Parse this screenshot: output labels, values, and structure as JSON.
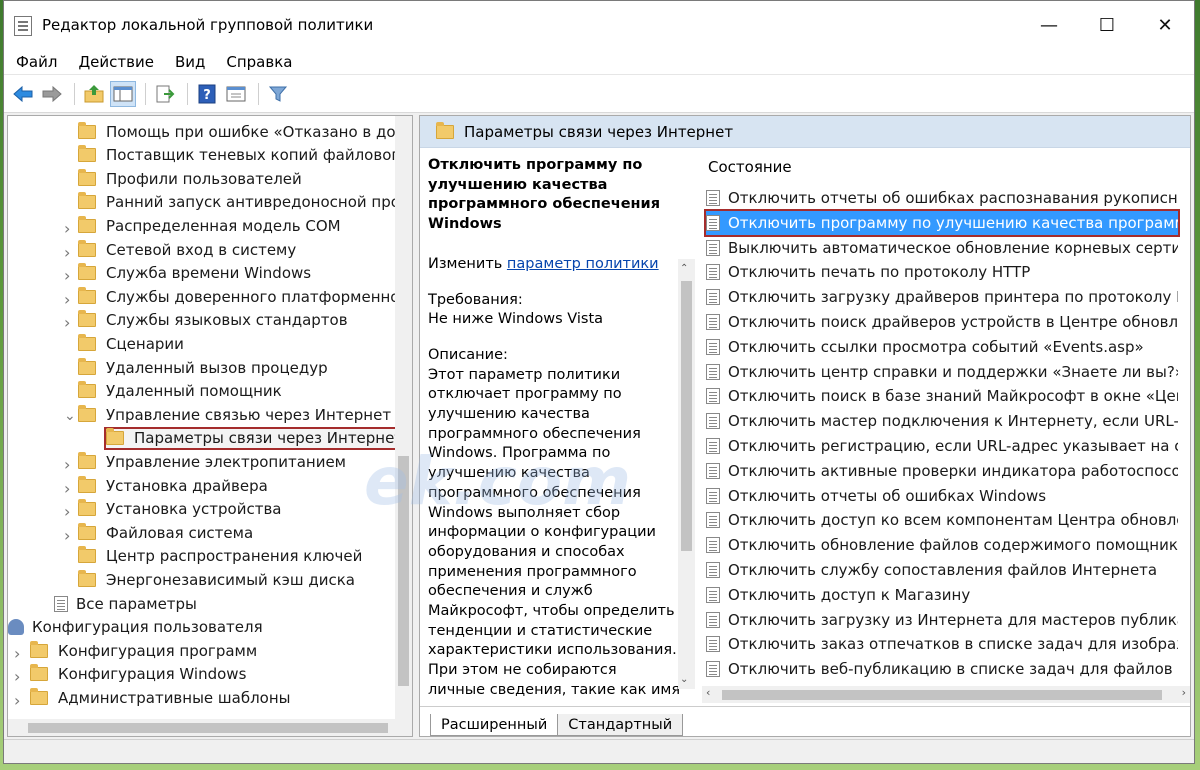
{
  "window": {
    "title": "Редактор локальной групповой политики"
  },
  "controls": {
    "minimize": "—",
    "maximize": "☐",
    "close": "✕"
  },
  "menu": [
    "Файл",
    "Действие",
    "Вид",
    "Справка"
  ],
  "toolbar_icons": [
    "back-arrow-icon",
    "forward-arrow-icon",
    "up-folder-icon",
    "show-hide-tree-icon",
    "export-list-icon",
    "help-icon",
    "properties-icon",
    "filter-icon"
  ],
  "tree": {
    "items": [
      {
        "label": "Помощь при ошибке «Отказано в дост",
        "expandable": false
      },
      {
        "label": "Поставщик теневых копий файлового",
        "expandable": false
      },
      {
        "label": "Профили пользователей",
        "expandable": false
      },
      {
        "label": "Ранний запуск антивредоносной прогр",
        "expandable": false
      },
      {
        "label": "Распределенная модель COM",
        "expandable": true
      },
      {
        "label": "Сетевой вход в систему",
        "expandable": true
      },
      {
        "label": "Служба времени Windows",
        "expandable": true
      },
      {
        "label": "Службы доверенного платформенного",
        "expandable": true
      },
      {
        "label": "Службы языковых стандартов",
        "expandable": true
      },
      {
        "label": "Сценарии",
        "expandable": false
      },
      {
        "label": "Удаленный вызов процедур",
        "expandable": false
      },
      {
        "label": "Удаленный помощник",
        "expandable": false
      },
      {
        "label": "Управление связью через Интернет",
        "expandable": true,
        "expanded": true
      },
      {
        "label": "Параметры связи через Интернет",
        "expandable": false,
        "selected": true
      },
      {
        "label": "Управление электропитанием",
        "expandable": true
      },
      {
        "label": "Установка драйвера",
        "expandable": true
      },
      {
        "label": "Установка устройства",
        "expandable": true
      },
      {
        "label": "Файловая система",
        "expandable": true
      },
      {
        "label": "Центр распространения ключей",
        "expandable": false
      },
      {
        "label": "Энергонезависимый кэш диска",
        "expandable": false
      },
      {
        "label": "Все параметры",
        "expandable": false
      },
      {
        "label": "Конфигурация пользователя",
        "expandable": false
      },
      {
        "label": "Конфигурация программ",
        "expandable": true
      },
      {
        "label": "Конфигурация Windows",
        "expandable": true
      },
      {
        "label": "Административные шаблоны",
        "expandable": true
      }
    ]
  },
  "right": {
    "header": "Параметры связи через Интернет",
    "policy_title": "Отключить программу по улучшению качества программного обеспечения Windows",
    "edit_prefix": "Изменить",
    "edit_link": "параметр политики",
    "requirements_label": "Требования:",
    "requirements_value": "Не ниже Windows Vista",
    "description_label": "Описание:",
    "description_lines": [
      "Этот параметр политики",
      "отключает программу по",
      "улучшению качества",
      "программного обеспечения",
      "Windows. Программа по",
      "улучшению качества",
      "программного обеспечения",
      "Windows выполняет сбор",
      "информации о конфигурации",
      "оборудования и способах",
      "применения программного",
      "обеспечения и служб",
      "Майкрософт, чтобы определить",
      "тенденции и статистические",
      "характеристики использования.",
      "При этом не собираются",
      "личные сведения, такие как имя"
    ],
    "column_header": "Состояние",
    "policies": [
      "Отключить отчеты об ошибках распознавания рукописного т",
      "Отключить программу по улучшению качества программно",
      "Выключить автоматическое обновление корневых сертифика",
      "Отключить печать по протоколу HTTP",
      "Отключить загрузку драйверов принтера по протоколу HTTP",
      "Отключить поиск драйверов устройств в Центре обновления",
      "Отключить ссылки просмотра событий «Events.asp»",
      "Отключить центр справки и поддержки «Знаете ли вы?»",
      "Отключить поиск в базе знаний Майкрософт в окне «Центр с",
      "Отключить мастер подключения к Интернету, если URL-адре",
      "Отключить регистрацию, если URL-адрес указывает на сайт М",
      "Отключить активные проверки индикатора работоспособнос",
      "Отключить отчеты об ошибках Windows",
      "Отключить доступ ко всем компонентам Центра обновления",
      "Отключить обновление файлов содержимого помощника по",
      "Отключить службу сопоставления файлов Интернета",
      "Отключить доступ к Магазину",
      "Отключить загрузку из Интернета для мастеров публикаций и",
      "Отключить заказ отпечатков в списке задач для изображени",
      "Отключить веб-публикацию в списке задач для файлов и па"
    ],
    "selected_policy_index": 1,
    "tabs": [
      "Расширенный",
      "Стандартный"
    ],
    "active_tab": "Расширенный"
  },
  "watermark": "ek.com",
  "colors": {
    "selection": "#3399ff",
    "highlight_outline": "#a52d2d",
    "header_bg": "#d7e4f2"
  }
}
